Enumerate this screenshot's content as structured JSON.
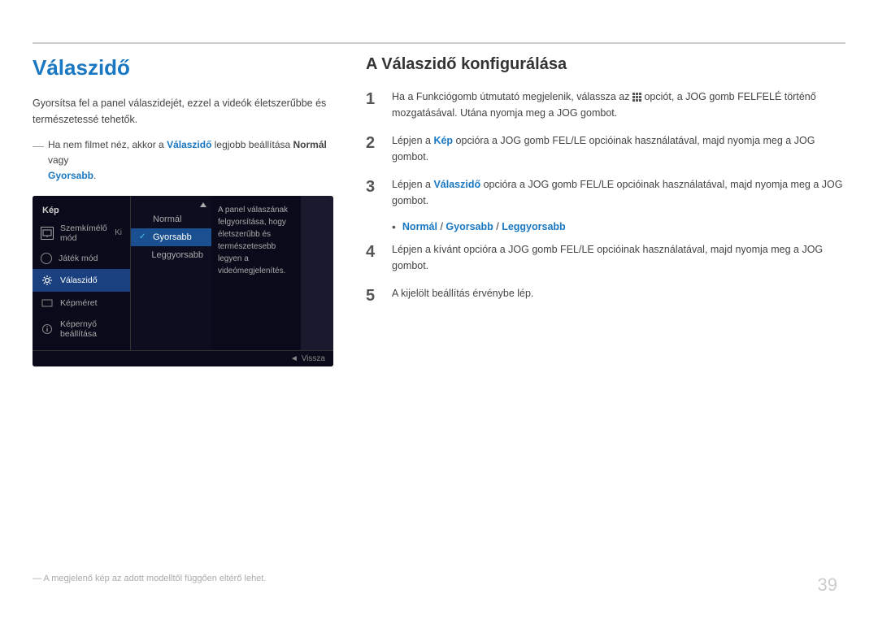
{
  "page": {
    "number": "39"
  },
  "left": {
    "title": "Válaszidő",
    "intro": "Gyorsítsa fel a panel válaszidejét, ezzel a videók életszerűbbe és természetessé tehetők.",
    "note_prefix": "Ha nem filmet néz, akkor a ",
    "note_link": "Válaszidő",
    "note_middle": " legjobb beállítása ",
    "note_bold": "Normál",
    "note_suffix": " vagy",
    "note_link2": "Gyorsabb",
    "note_suffix2": ".",
    "osd": {
      "left_label": "Kép",
      "items": [
        {
          "label": "Szemkímélő mód",
          "shortcut": "Ki"
        },
        {
          "label": "Játék mód",
          "shortcut": ""
        },
        {
          "label": "Válaszidő",
          "shortcut": "",
          "active": true
        },
        {
          "label": "Képméret",
          "shortcut": ""
        },
        {
          "label": "Képernyő beállítása",
          "shortcut": ""
        }
      ],
      "submenu": [
        {
          "label": "Normál",
          "selected": false
        },
        {
          "label": "Gyorsabb",
          "selected": true
        },
        {
          "label": "Leggyorsabb",
          "selected": false
        }
      ],
      "description": "A panel válaszának felgyorsítása, hogy életszerűbb és természetesebb legyen a videómegjelenítés.",
      "back_label": "Vissza"
    },
    "footnote": "— A megjelenő kép az adott modelltől függően eltérő lehet."
  },
  "right": {
    "title": "A Válaszidő konfigurálása",
    "steps": [
      {
        "number": "1",
        "parts": [
          {
            "type": "text",
            "value": "Ha a Funkciógomb útmutató megjelenik, válassza az "
          },
          {
            "type": "icon",
            "value": "grid"
          },
          {
            "type": "text",
            "value": " opciót, a JOG gomb FELFELÉ történő mozgatásával. Utána nyomja meg a JOG gombot."
          }
        ]
      },
      {
        "number": "2",
        "text": "Lépjen a Kép opcióra a JOG gomb FEL/LE opcióinak használatával, majd nyomja meg a JOG gombot.",
        "link": "Kép"
      },
      {
        "number": "3",
        "text": "Lépjen a Válaszidő opcióra a JOG gomb FEL/LE opcióinak használatával, majd nyomja meg a JOG gombot.",
        "link": "Válaszidő"
      },
      {
        "number": "4",
        "text": "Lépjen a kívánt opcióra a JOG gomb FEL/LE opcióinak használatával, majd nyomja meg a JOG gombot."
      },
      {
        "number": "5",
        "text": "A kijelölt beállítás érvénybe lép."
      }
    ],
    "bullet": {
      "option1": "Normál",
      "sep1": " / ",
      "option2": "Gyorsabb",
      "sep2": " / ",
      "option3": "Leggyorsabb"
    }
  }
}
